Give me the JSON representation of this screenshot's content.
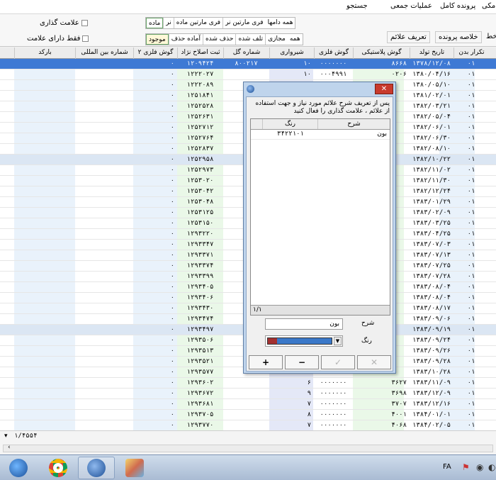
{
  "toolbar": {
    "menu": [
      "مکی",
      "پرونده کامل",
      "عملیات جمعی",
      "جستجو"
    ],
    "menu2": [
      "خط",
      "خلاصه پرونده",
      "تعریف علائم"
    ]
  },
  "filters": {
    "checkbox_mark": "علامت گذاری",
    "checkbox_only_marked": "فقط دارای علامت",
    "sex_group": [
      "همه دامها",
      "فری مارتین نر",
      "فری مارتین ماده",
      "نر",
      "ماده"
    ],
    "state_group": [
      "همه",
      "مجازی",
      "تلف شده",
      "حذف شده",
      "آماده حذف",
      "موجود"
    ]
  },
  "columns": [
    "تکرار بدن",
    "تاریخ تولد",
    "گوش پلاستیکی",
    "گوش فلزی",
    "شیرواری",
    "شماره گل",
    "ثبت اصلاح نژاد",
    "گوش فلزی ۲",
    "شماره بین المللی",
    "بارکد"
  ],
  "rows": [
    {
      "n": "۰۱",
      "birth": "۱۳۷۸/۱۲/۰۸",
      "plastic": "۸۶۶۸",
      "metal": "۰۰۰۰۰۰۰",
      "milk": "۱۰",
      "gol": "۸۰۰۲۱۷",
      "reg": "۱۲۰۹۴۲۴",
      "m2": "۰"
    },
    {
      "n": "۰۱",
      "birth": "۱۳۸۰/۰۴/۱۶",
      "plastic": "۰۲۰۶",
      "metal": "۰۰۰۴۹۹۱",
      "milk": "۱۰",
      "gol": "",
      "reg": "۱۲۲۲۰۲۷",
      "m2": "۰"
    },
    {
      "n": "۰۱",
      "birth": "۱۳۸۰/۰۵/۱۰",
      "plastic": "",
      "metal": "",
      "milk": "",
      "gol": "",
      "reg": "۱۲۲۲۰۸۹",
      "m2": "۰"
    },
    {
      "n": "۰۱",
      "birth": "۱۳۸۱/۰۲/۰۱",
      "plastic": "",
      "metal": "",
      "milk": "",
      "gol": "",
      "reg": "۱۲۵۱۸۴۱",
      "m2": "۰"
    },
    {
      "n": "۰۱",
      "birth": "۱۳۸۲/۰۳/۲۱",
      "plastic": "",
      "metal": "",
      "milk": "",
      "gol": "",
      "reg": "۱۲۵۲۵۲۸",
      "m2": "۰"
    },
    {
      "n": "۰۱",
      "birth": "۱۳۸۲/۰۵/۰۴",
      "plastic": "",
      "metal": "",
      "milk": "",
      "gol": "",
      "reg": "۱۲۵۲۶۳۱",
      "m2": "۰"
    },
    {
      "n": "۰۱",
      "birth": "۱۳۸۲/۰۶/۰۱",
      "plastic": "",
      "metal": "",
      "milk": "",
      "gol": "",
      "reg": "۱۲۵۲۷۱۲",
      "m2": "۰"
    },
    {
      "n": "۰۱",
      "birth": "۱۳۸۲/۰۶/۳۰",
      "plastic": "",
      "metal": "",
      "milk": "",
      "gol": "",
      "reg": "۱۲۵۲۷۶۴",
      "m2": "۰"
    },
    {
      "n": "۰۱",
      "birth": "۱۳۸۲/۰۸/۱۰",
      "plastic": "",
      "metal": "",
      "milk": "",
      "gol": "",
      "reg": "۱۲۵۲۸۳۷",
      "m2": "۰"
    },
    {
      "n": "۰۱",
      "birth": "۱۳۸۲/۱۰/۲۲",
      "plastic": "",
      "metal": "",
      "milk": "",
      "gol": "",
      "reg": "۱۲۵۲۹۵۸",
      "m2": "۰"
    },
    {
      "n": "۰۱",
      "birth": "۱۳۸۲/۱۱/۰۲",
      "plastic": "",
      "metal": "",
      "milk": "",
      "gol": "",
      "reg": "۱۲۵۲۹۷۳",
      "m2": "۰"
    },
    {
      "n": "۰۱",
      "birth": "۱۳۸۲/۱۱/۳۰",
      "plastic": "",
      "metal": "",
      "milk": "",
      "gol": "",
      "reg": "۱۲۵۳۰۲۰",
      "m2": "۰"
    },
    {
      "n": "۰۱",
      "birth": "۱۳۸۲/۱۲/۲۴",
      "plastic": "",
      "metal": "",
      "milk": "",
      "gol": "",
      "reg": "۱۲۵۳۰۴۲",
      "m2": "۰"
    },
    {
      "n": "۰۱",
      "birth": "۱۳۸۳/۰۱/۲۹",
      "plastic": "",
      "metal": "",
      "milk": "",
      "gol": "",
      "reg": "۱۲۵۳۰۴۸",
      "m2": "۰"
    },
    {
      "n": "۰۱",
      "birth": "۱۳۸۳/۰۲/۰۹",
      "plastic": "",
      "metal": "",
      "milk": "",
      "gol": "",
      "reg": "۱۲۵۳۱۲۵",
      "m2": "۰"
    },
    {
      "n": "۰۱",
      "birth": "۱۳۸۳/۰۳/۲۵",
      "plastic": "",
      "metal": "",
      "milk": "",
      "gol": "",
      "reg": "۱۲۵۳۱۵۰",
      "m2": "۰"
    },
    {
      "n": "۰۱",
      "birth": "۱۳۸۳/۰۴/۲۵",
      "plastic": "",
      "metal": "",
      "milk": "",
      "gol": "",
      "reg": "۱۲۹۳۲۲۰",
      "m2": "۰"
    },
    {
      "n": "۰۱",
      "birth": "۱۳۸۳/۰۷/۰۳",
      "plastic": "",
      "metal": "",
      "milk": "",
      "gol": "",
      "reg": "۱۲۹۳۳۴۷",
      "m2": "۰"
    },
    {
      "n": "۰۱",
      "birth": "۱۳۸۳/۰۷/۱۳",
      "plastic": "",
      "metal": "",
      "milk": "",
      "gol": "",
      "reg": "۱۲۹۳۳۷۱",
      "m2": "۰"
    },
    {
      "n": "۰۱",
      "birth": "۱۳۸۳/۰۷/۲۵",
      "plastic": "",
      "metal": "",
      "milk": "",
      "gol": "",
      "reg": "۱۲۹۳۳۷۴",
      "m2": "۰"
    },
    {
      "n": "۰۱",
      "birth": "۱۳۸۳/۰۷/۲۸",
      "plastic": "",
      "metal": "",
      "milk": "",
      "gol": "",
      "reg": "۱۲۹۳۳۹۹",
      "m2": "۰"
    },
    {
      "n": "۰۱",
      "birth": "۱۳۸۳/۰۸/۰۴",
      "plastic": "",
      "metal": "",
      "milk": "",
      "gol": "",
      "reg": "۱۲۹۳۴۰۵",
      "m2": "۰"
    },
    {
      "n": "۰۱",
      "birth": "۱۳۸۳/۰۸/۰۴",
      "plastic": "",
      "metal": "",
      "milk": "",
      "gol": "",
      "reg": "۱۲۹۳۴۰۶",
      "m2": "۰"
    },
    {
      "n": "۰۱",
      "birth": "۱۳۸۳/۰۸/۱۷",
      "plastic": "",
      "metal": "",
      "milk": "",
      "gol": "",
      "reg": "۱۲۹۳۴۳۰",
      "m2": "۰"
    },
    {
      "n": "۰۱",
      "birth": "۱۳۸۳/۰۹/۰۶",
      "plastic": "",
      "metal": "",
      "milk": "",
      "gol": "",
      "reg": "۱۲۹۳۴۷۴",
      "m2": "۰"
    },
    {
      "n": "۰۱",
      "birth": "۱۳۸۳/۰۹/۱۹",
      "plastic": "",
      "metal": "",
      "milk": "",
      "gol": "",
      "reg": "۱۲۹۳۴۹۷",
      "m2": "۰"
    },
    {
      "n": "۰۱",
      "birth": "۱۳۸۳/۰۹/۲۴",
      "plastic": "",
      "metal": "",
      "milk": "",
      "gol": "",
      "reg": "۱۲۹۳۵۰۶",
      "m2": "۰"
    },
    {
      "n": "۰۱",
      "birth": "۱۳۸۳/۰۹/۲۶",
      "plastic": "",
      "metal": "",
      "milk": "",
      "gol": "",
      "reg": "۱۲۹۳۵۱۳",
      "m2": "۰"
    },
    {
      "n": "۰۱",
      "birth": "۱۳۸۳/۰۹/۲۸",
      "plastic": "",
      "metal": "",
      "milk": "",
      "gol": "",
      "reg": "۱۲۹۳۵۲۱",
      "m2": "۰"
    },
    {
      "n": "۰۱",
      "birth": "۱۳۸۳/۱۰/۲۸",
      "plastic": "",
      "metal": "",
      "milk": "",
      "gol": "",
      "reg": "۱۲۹۳۵۷۷",
      "m2": "۰"
    },
    {
      "n": "۰۱",
      "birth": "۱۳۸۳/۱۱/۰۹",
      "plastic": "۳۶۲۷",
      "metal": "۰۰۰۰۰۰۰",
      "milk": "۶",
      "gol": "",
      "reg": "۱۲۹۳۶۰۲",
      "m2": "۰"
    },
    {
      "n": "۰۱",
      "birth": "۱۳۸۳/۱۲/۰۹",
      "plastic": "۳۶۹۸",
      "metal": "۰۰۰۰۰۰۰",
      "milk": "۹",
      "gol": "",
      "reg": "۱۲۹۳۶۷۲",
      "m2": "۰"
    },
    {
      "n": "۰۱",
      "birth": "۱۳۸۳/۱۲/۱۶",
      "plastic": "۳۷۰۷",
      "metal": "۰۰۰۰۰۰۰",
      "milk": "۷",
      "gol": "",
      "reg": "۱۲۹۳۶۸۱",
      "m2": "۰"
    },
    {
      "n": "۰۱",
      "birth": "۱۳۸۴/۰۱/۰۱",
      "plastic": "۴۰۰۱",
      "metal": "۰۰۰۰۰۰۰",
      "milk": "۸",
      "gol": "",
      "reg": "۱۲۹۳۷۰۵",
      "m2": "۰"
    },
    {
      "n": "۰۱",
      "birth": "۱۳۸۴/۰۲/۰۵",
      "plastic": "۴۰۶۸",
      "metal": "۰۰۰۰۰۰۰",
      "milk": "۷",
      "gol": "",
      "reg": "۱۲۹۳۷۷۰",
      "m2": "۰"
    }
  ],
  "status": {
    "record": "۱/۴۵۵۴"
  },
  "dialog": {
    "message": "پس از تعریف شرح علائم مورد نیاز و جهت استفاده از علائم ، علامت گذاری را فعال کنید",
    "col_desc": "شرح",
    "col_color": "رنگ",
    "row_desc": "بون",
    "row_color": "۳۴۲۲۱۰۱",
    "counter": "۱/۱",
    "label_desc": "شرح",
    "label_color": "رنگ",
    "desc_value": "بون",
    "color_main": "#3a78c8",
    "color_swatch": "#a33030",
    "btn_add": "+",
    "btn_remove": "−",
    "btn_confirm": "✓",
    "btn_cancel": "✕"
  },
  "taskbar": {
    "lang": "FA"
  }
}
